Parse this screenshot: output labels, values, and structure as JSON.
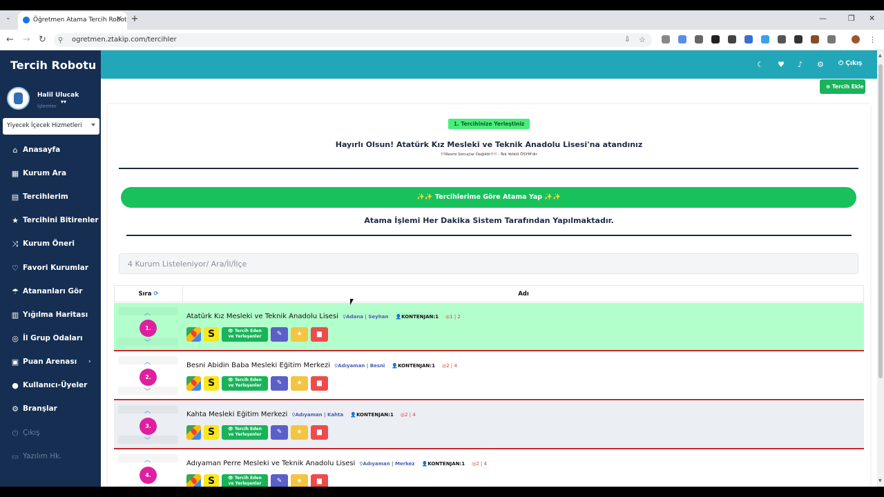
{
  "browser": {
    "tab_title": "Öğretmen Atama Tercih Robotu",
    "url": "ogretmen.ztakip.com/tercihler"
  },
  "sidebar": {
    "brand": "Tercih Robotu",
    "user_name": "Halil Ulucak",
    "user_sub": "İşlemler",
    "branch_select": "Yiyecek İçecek Hizmetleri",
    "items": [
      {
        "icon": "⌂",
        "icon_name": "home-icon",
        "label": "Anasayfa"
      },
      {
        "icon": "▦",
        "icon_name": "building-icon",
        "label": "Kurum Ara"
      },
      {
        "icon": "▤",
        "icon_name": "document-icon",
        "label": "Tercihlerim"
      },
      {
        "icon": "★",
        "icon_name": "star-icon",
        "label": "Tercihini Bitirenler"
      },
      {
        "icon": "⤨",
        "icon_name": "shuffle-icon",
        "label": "Kurum Öneri"
      },
      {
        "icon": "♡",
        "icon_name": "heart-icon",
        "label": "Favori Kurumlar"
      },
      {
        "icon": "☂",
        "icon_name": "umbrella-icon",
        "label": "Atananları Gör"
      },
      {
        "icon": "▥",
        "icon_name": "map-icon",
        "label": "Yığılma Haritası"
      },
      {
        "icon": "◎",
        "icon_name": "chat-icon",
        "label": "İl Grup Odaları"
      },
      {
        "icon": "▣",
        "icon_name": "arena-icon",
        "label": "Puan Arenası"
      },
      {
        "icon": "●",
        "icon_name": "user-icon",
        "label": "Kullanıcı-Üyeler"
      },
      {
        "icon": "⚙",
        "icon_name": "cogs-icon",
        "label": "Branşlar"
      },
      {
        "icon": "⏻",
        "icon_name": "power-icon",
        "label": "Çıkış"
      },
      {
        "icon": "▭",
        "icon_name": "software-icon",
        "label": "Yazılım Hk."
      }
    ]
  },
  "header": {
    "logout_label": "Çıkış",
    "add_button": "Tercih Ekle"
  },
  "result": {
    "badge": "1. Tercihinize Yerleştiniz",
    "congrats": "Hayırlı Olsun! Atatürk Kız Mesleki ve Teknik Anadolu Lisesi'na atandınız",
    "disclaimer": "!!!Resmi Sonuçlar Değildir!!!! - Tek Yetkili ÖSYM'dir",
    "action_button": "Tercihlerime Göre Atama Yap",
    "info": "Atama İşlemi Her Dakika Sistem Tarafından Yapılmaktadır."
  },
  "search": {
    "placeholder": "4 Kurum Listeleniyor/ Ara/İl/İlçe"
  },
  "table": {
    "col_order": "Sıra",
    "col_name": "Adı",
    "rows": [
      {
        "rank": "1.",
        "name": "Atatürk Kız Mesleki ve Teknik Anadolu Lisesi",
        "loc": "Adana | Seyhan",
        "quota": "KONTENJAN:1",
        "stat": "1 | 2",
        "bg": "#b3ffcc"
      },
      {
        "rank": "2.",
        "name": "Besni Abidin Baba Mesleki Eğitim Merkezi",
        "loc": "Adıyaman | Besni",
        "quota": "KONTENJAN:1",
        "stat": "2 | 4",
        "bg": "#ffffff"
      },
      {
        "rank": "3.",
        "name": "Kahta Mesleki Eğitim Merkezi",
        "loc": "Adıyaman | Kahta",
        "quota": "KONTENJAN:1",
        "stat": "2 | 4",
        "bg": "#ebeef3"
      },
      {
        "rank": "4.",
        "name": "Adıyaman Perre Mesleki ve Teknik Anadolu Lisesi",
        "loc": "Adıyaman | Merkez",
        "quota": "KONTENJAN:1",
        "stat": "2 | 4",
        "bg": "#ffffff"
      }
    ],
    "buttons": {
      "s_label": "S",
      "tercih_line1": "Tercih Eden",
      "tercih_line2": "ve Yerleşenler"
    }
  },
  "colors": {
    "sidebar_bg": "#152e52",
    "header_bg": "#22a7b9",
    "success": "#18c15c",
    "rank_badge": "#e01fa0",
    "row_divider": "#c8242c"
  }
}
